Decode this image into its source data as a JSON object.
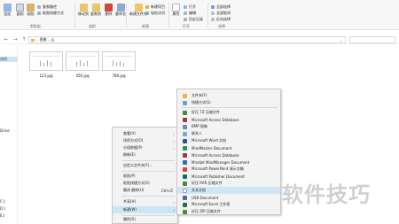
{
  "ribbon": {
    "pin_label": "固定",
    "copy_label": "复制",
    "paste_label": "粘贴",
    "copy_path_label": "复制路径",
    "paste_shortcut_label": "粘贴快捷方式",
    "move_to_label": "移动到",
    "copy_to_label": "复制到",
    "delete_label": "删除",
    "rename_label": "重命名",
    "new_folder_label": "新建文件夹",
    "new_item_label": "新建项目",
    "easy_access_label": "轻松访问",
    "properties_label": "属性",
    "open_label": "打开",
    "edit_label": "编辑",
    "history_label": "历史记录",
    "select_all_label": "全部选择",
    "select_none_label": "全部取消",
    "invert_selection_label": "反向选择",
    "groups": [
      "剪贴板",
      "组织",
      "新建",
      "打开",
      "选择"
    ]
  },
  "address": {
    "path": [
      "图像",
      "6"
    ],
    "search_placeholder": ""
  },
  "sidebar": {
    "items": [
      "访问",
      "",
      "",
      "",
      "",
      "Drive",
      "",
      "",
      "",
      "",
      "",
      "",
      "",
      "C:)",
      "D:)",
      "E:)"
    ]
  },
  "files": [
    {
      "name": "123.jpg"
    },
    {
      "name": "456.jpg"
    },
    {
      "name": "789.jpg"
    }
  ],
  "context_menu": {
    "items": [
      {
        "label": "查看(V)",
        "arrow": "›"
      },
      {
        "label": "排序方式(O)",
        "arrow": "›"
      },
      {
        "label": "分组依据(P)",
        "arrow": "›"
      },
      {
        "label": "刷新(E)"
      },
      {
        "label": "自定义文件夹(F)..."
      },
      {
        "label": "粘贴(P)"
      },
      {
        "label": "粘贴快捷方式(S)"
      },
      {
        "label": "撤消 删除(U)",
        "shortcut": "Ctrl+Z"
      },
      {
        "label": "共享(H)",
        "arrow": "›"
      },
      {
        "label": "新建(W)",
        "arrow": "›"
      },
      {
        "label": "属性(R)"
      }
    ]
  },
  "new_submenu": {
    "items": [
      {
        "label": "文件夹(F)",
        "color": "#e8b84a"
      },
      {
        "label": "快捷方式(S)",
        "color": "#6aa0d8"
      },
      {
        "label": "好压 7Z 压缩文件",
        "color": "#4a8a3a"
      },
      {
        "label": "Microsoft Access Database",
        "color": "#a4373a"
      },
      {
        "label": "BMP 图像",
        "color": "#5c8fc8"
      },
      {
        "label": "联系人",
        "color": "#7fa7d0"
      },
      {
        "label": "Microsoft Word 文档",
        "color": "#2b5797"
      },
      {
        "label": "MindMaster Document",
        "color": "#2f8f6a"
      },
      {
        "label": "Microsoft Access Database",
        "color": "#a4373a"
      },
      {
        "label": "Mindjet MindManager Document",
        "color": "#2a6fb8"
      },
      {
        "label": "Microsoft PowerPoint 演示文稿",
        "color": "#d24726"
      },
      {
        "label": "Microsoft Publisher Document",
        "color": "#077568"
      },
      {
        "label": "好压 RAR 压缩文件",
        "color": "#4a8a3a"
      },
      {
        "label": "文本文档",
        "color": "#d9d9d9"
      },
      {
        "label": "USB Document",
        "color": "#4d6a9a"
      },
      {
        "label": "Microsoft Excel 工作表",
        "color": "#217346"
      },
      {
        "label": "好压 ZIP 压缩文件",
        "color": "#4a8a3a"
      }
    ]
  },
  "watermark": "软件技巧"
}
